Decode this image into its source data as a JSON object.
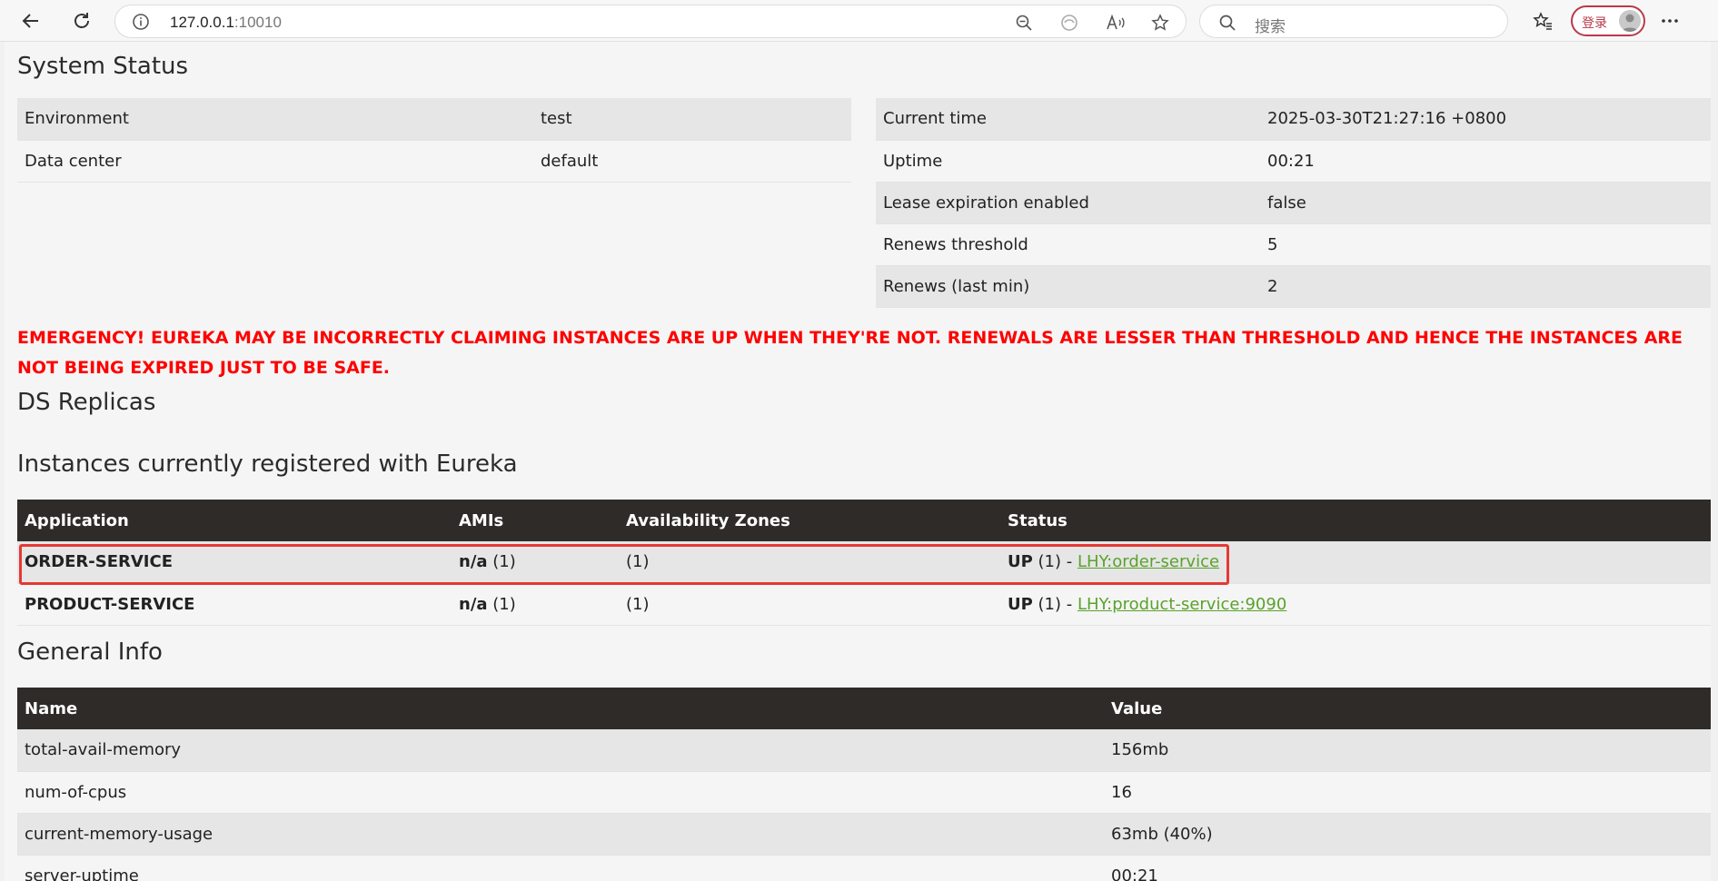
{
  "browser": {
    "url_host": "127.0.0.1",
    "url_port": ":10010",
    "search_placeholder": "搜索",
    "login_label": "登录"
  },
  "system_status": {
    "heading": "System Status",
    "left": [
      {
        "key": "Environment",
        "value": "test"
      },
      {
        "key": "Data center",
        "value": "default"
      }
    ],
    "right": [
      {
        "key": "Current time",
        "value": "2025-03-30T21:27:16 +0800"
      },
      {
        "key": "Uptime",
        "value": "00:21"
      },
      {
        "key": "Lease expiration enabled",
        "value": "false"
      },
      {
        "key": "Renews threshold",
        "value": "5"
      },
      {
        "key": "Renews (last min)",
        "value": "2"
      }
    ]
  },
  "emergency": "EMERGENCY! EUREKA MAY BE INCORRECTLY CLAIMING INSTANCES ARE UP WHEN THEY'RE NOT. RENEWALS ARE LESSER THAN THRESHOLD AND HENCE THE INSTANCES ARE NOT BEING EXPIRED JUST TO BE SAFE.",
  "ds_replicas": {
    "heading": "DS Replicas"
  },
  "instances": {
    "heading": "Instances currently registered with Eureka",
    "columns": [
      "Application",
      "AMIs",
      "Availability Zones",
      "Status"
    ],
    "rows": [
      {
        "app": "ORDER-SERVICE",
        "amis_bold": "n/a",
        "amis_count": " (1)",
        "zones": "(1)",
        "status_bold": "UP",
        "status_text": " (1) - ",
        "link": "LHY:order-service"
      },
      {
        "app": "PRODUCT-SERVICE",
        "amis_bold": "n/a",
        "amis_count": " (1)",
        "zones": "(1)",
        "status_bold": "UP",
        "status_text": " (1) - ",
        "link": "LHY:product-service:9090"
      }
    ]
  },
  "general_info": {
    "heading": "General Info",
    "columns": [
      "Name",
      "Value"
    ],
    "rows": [
      {
        "name": "total-avail-memory",
        "value": "156mb"
      },
      {
        "name": "num-of-cpus",
        "value": "16"
      },
      {
        "name": "current-memory-usage",
        "value": "63mb (40%)"
      },
      {
        "name": "server-uptime",
        "value": "00:21"
      }
    ]
  }
}
